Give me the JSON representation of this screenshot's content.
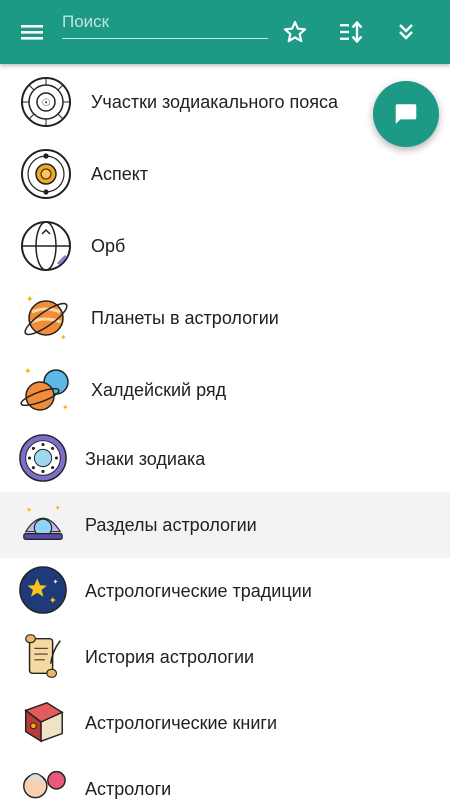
{
  "search": {
    "placeholder": "Поиск",
    "value": ""
  },
  "toolbar": {
    "menu_icon": "hamburger-menu-icon",
    "favorite_icon": "star-outline-icon",
    "sort_icon": "sort-icon",
    "collapse_icon": "double-chevron-down-icon"
  },
  "fab": {
    "icon": "chat-message-icon"
  },
  "colors": {
    "accent": "#1d9a86",
    "selected_row": "#f3f3f3",
    "text": "#212121"
  },
  "items": [
    {
      "label": "Участки зодиакального пояса",
      "icon": "zodiac-wheel-icon"
    },
    {
      "label": "Аспект",
      "icon": "aspect-orbit-icon"
    },
    {
      "label": "Орб",
      "icon": "orb-sphere-icon"
    },
    {
      "label": "Планеты в астрологии",
      "icon": "planet-icon"
    },
    {
      "label": "Халдейский ряд",
      "icon": "planets-group-icon"
    },
    {
      "label": "Знаки зодиака",
      "icon": "zodiac-signs-icon"
    },
    {
      "label": "Разделы астрологии",
      "icon": "crystal-ball-icon"
    },
    {
      "label": "Астрологические традиции",
      "icon": "stars-night-icon"
    },
    {
      "label": "История астрологии",
      "icon": "scroll-quill-icon"
    },
    {
      "label": "Астрологические книги",
      "icon": "book-icon"
    },
    {
      "label": "Астрологи",
      "icon": "astrologer-icon"
    }
  ]
}
